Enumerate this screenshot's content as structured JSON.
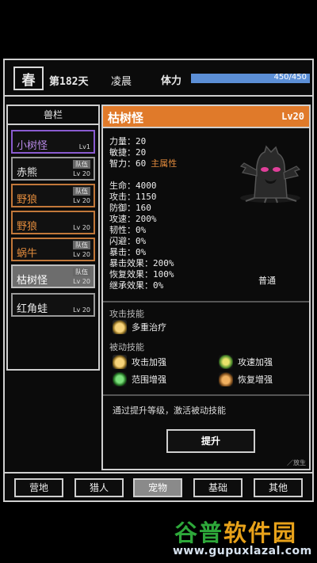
{
  "header": {
    "season": "春",
    "day": "第182天",
    "time_of_day": "凌晨",
    "stamina_label": "体力",
    "stamina_value": "450/450",
    "stamina_fraction": 1.0
  },
  "pet_list": {
    "title": "兽栏",
    "items": [
      {
        "name": "小树怪",
        "level": "Lv1",
        "tag": "",
        "rarity": "purple",
        "selected": false
      },
      {
        "name": "赤熊",
        "level": "Lv 20",
        "tag": "队伍",
        "rarity": "white",
        "selected": false
      },
      {
        "name": "野狼",
        "level": "Lv 20",
        "tag": "队伍",
        "rarity": "orange",
        "selected": false
      },
      {
        "name": "野狼",
        "level": "Lv 20",
        "tag": "",
        "rarity": "orange",
        "selected": false
      },
      {
        "name": "蜗牛",
        "level": "Lv 20",
        "tag": "队伍",
        "rarity": "orange",
        "selected": false
      },
      {
        "name": "枯树怪",
        "level": "Lv 20",
        "tag": "队伍",
        "rarity": "white",
        "selected": true
      },
      {
        "name": "红角蛙",
        "level": "Lv 20",
        "tag": "",
        "rarity": "white",
        "selected": false
      }
    ]
  },
  "detail": {
    "name": "枯树怪",
    "level": "Lv20",
    "attributes": [
      {
        "text": "力量：20",
        "main": ""
      },
      {
        "text": "敏捷：20",
        "main": ""
      },
      {
        "text": "智力：60",
        "main": "主属性"
      }
    ],
    "stats": [
      "生命：4000",
      "攻击：1150",
      "防御：160",
      "攻速：200%",
      "韧性：0%",
      "闪避：0%",
      "暴击：0%",
      "暴击效果：200%",
      "恢复效果：100%",
      "继承效果：0%"
    ],
    "attack_type": "普通",
    "attack_skill_title": "攻击技能",
    "attack_skill": "多重治疗",
    "passive_skill_title": "被动技能",
    "passive_skills": [
      "攻击加强",
      "攻速加强",
      "范围增强",
      "恢复增强"
    ],
    "hint": "通过提升等级，激活被动技能",
    "upgrade_label": "提升",
    "release_label": "放生"
  },
  "nav": {
    "items": [
      "营地",
      "猎人",
      "宠物",
      "基础",
      "其他"
    ],
    "active": "宠物"
  },
  "watermark": {
    "logo_part1": "谷普",
    "logo_part2": "软件园",
    "url": "www.gupuxlazal.com"
  },
  "colors": {
    "accent_orange": "#e07a2a",
    "stamina_blue": "#5c8fd6",
    "rarity_purple": "#8a5bd0",
    "rarity_orange": "#c2783a"
  }
}
